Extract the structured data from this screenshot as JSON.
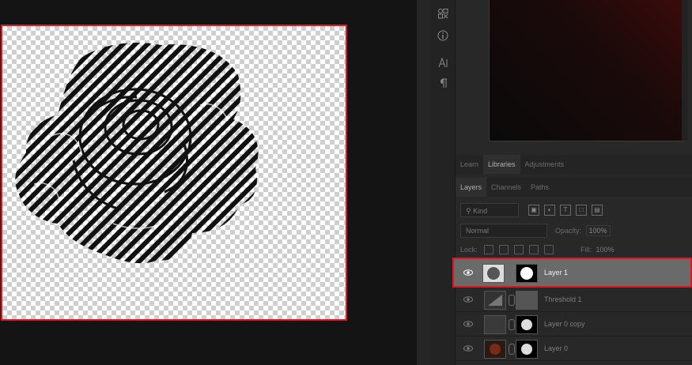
{
  "right_panel": {
    "tabs_row1": [
      {
        "label": "Learn",
        "active": false
      },
      {
        "label": "Libraries",
        "active": true
      },
      {
        "label": "Adjustments",
        "active": false
      }
    ],
    "tabs_row2": [
      {
        "label": "Layers",
        "active": true
      },
      {
        "label": "Channels",
        "active": false
      },
      {
        "label": "Paths",
        "active": false
      }
    ],
    "filter": {
      "kind_label": "Kind"
    },
    "blend": {
      "mode": "Normal",
      "opacity_label": "Opacity:",
      "opacity_value": "100%"
    },
    "lock": {
      "label": "Lock:",
      "fill_label": "Fill:",
      "fill_value": "100%"
    },
    "layers": [
      {
        "name": "Layer 1",
        "selected": true
      },
      {
        "name": "Threshold 1",
        "selected": false
      },
      {
        "name": "Layer 0 copy",
        "selected": false
      },
      {
        "name": "Layer 0",
        "selected": false
      }
    ]
  },
  "icon_bar": {
    "icons": [
      "glyphs-icon",
      "info-icon",
      "character-icon",
      "paragraph-icon"
    ]
  },
  "colors": {
    "selection_outline": "#e3141b",
    "panel_bg": "#282828",
    "canvas_bg": "#141414"
  }
}
